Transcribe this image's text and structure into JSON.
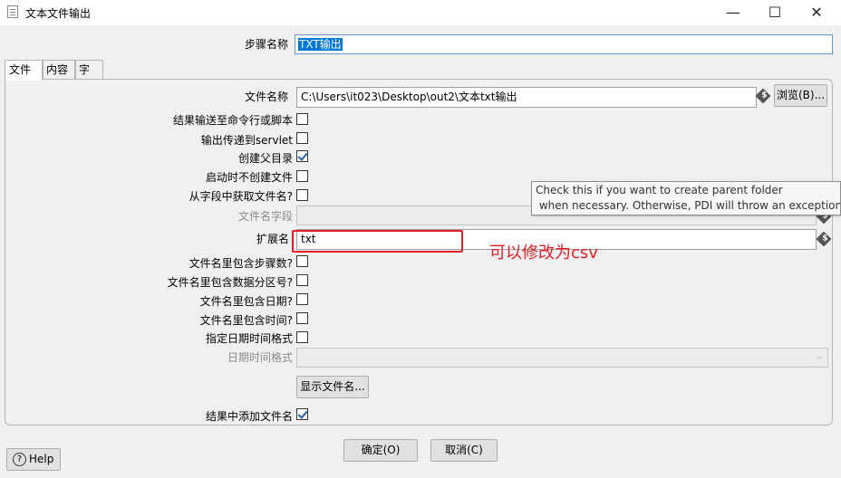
{
  "window": {
    "title": "文本文件输出",
    "minimize": "—",
    "maximize": "☐",
    "close": "✕"
  },
  "step": {
    "label": "步骤名称",
    "value": "TXT输出"
  },
  "tabs": [
    {
      "label": "文件",
      "active": true
    },
    {
      "label": "内容",
      "active": false
    },
    {
      "label": "字段",
      "active": false
    }
  ],
  "file": {
    "filename_label": "文件名称",
    "filename_value": "C:\\Users\\it023\\Desktop\\out2\\文本txt输出",
    "browse_label": "浏览(B)...",
    "var_symbol": "$",
    "options": [
      {
        "label": "结果输送至命令行或脚本",
        "checked": false
      },
      {
        "label": "输出传递到servlet",
        "checked": false
      },
      {
        "label": "创建父目录",
        "checked": true
      },
      {
        "label": "启动时不创建文件",
        "checked": false
      },
      {
        "label": "从字段中获取文件名?",
        "checked": false
      }
    ],
    "field_name_label": "文件名字段",
    "extension_label": "扩展名",
    "extension_value": "txt",
    "name_options": [
      {
        "label": "文件名里包含步骤数?",
        "checked": false
      },
      {
        "label": "文件名里包含数据分区号?",
        "checked": false
      },
      {
        "label": "文件名里包含日期?",
        "checked": false
      },
      {
        "label": "文件名里包含时间?",
        "checked": false
      },
      {
        "label": "指定日期时间格式",
        "checked": false
      }
    ],
    "datetime_format_label": "日期时间格式",
    "show_filename_label": "显示文件名...",
    "add_to_result_label": "结果中添加文件名",
    "add_to_result_checked": true
  },
  "tooltip": {
    "text": "Check this if you want to create parent folder\n when necessary. Otherwise, PDI will throw an exception when"
  },
  "annotation": {
    "text": "可以修改为csv",
    "color": "#e0202a"
  },
  "footer": {
    "help_label": "Help",
    "ok_label": "确定(O)",
    "cancel_label": "取消(C)"
  },
  "colors": {
    "selection": "#0078d7",
    "accent_red": "#e0202a"
  }
}
